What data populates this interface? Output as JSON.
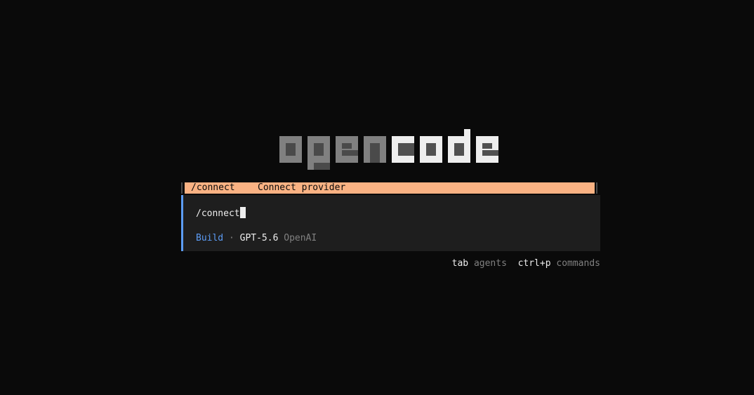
{
  "logo": {
    "text_left": "open",
    "text_right": "code",
    "colors": {
      "left_light": "#808080",
      "left_dark": "#4a4a4a",
      "right_light": "#eeeeee",
      "right_dark": "#505050"
    }
  },
  "suggestions": [
    {
      "command": "/connect",
      "description": "Connect provider",
      "selected": true
    }
  ],
  "prompt": {
    "value": "/connect",
    "agent": "Build",
    "separator": "·",
    "model": "GPT-5.6",
    "provider": "OpenAI"
  },
  "hints": [
    {
      "key": "tab",
      "label": "agents"
    },
    {
      "key": "ctrl+p",
      "label": "commands"
    }
  ],
  "colors": {
    "background": "#0a0a0a",
    "panel": "#1e1e1e",
    "accent": "#5c9cf5",
    "highlight": "#fab283",
    "text": "#eeeeee",
    "muted": "#808080"
  }
}
